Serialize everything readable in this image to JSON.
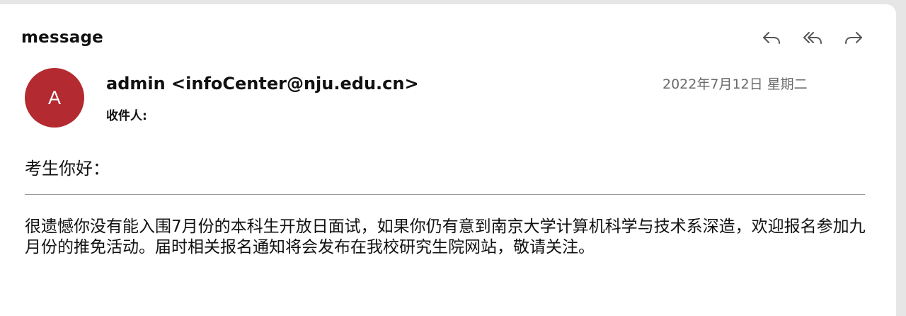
{
  "header": {
    "title": "message"
  },
  "toolbar": {
    "reply_icon": "reply-icon",
    "reply_all_icon": "reply-all-icon",
    "forward_icon": "forward-icon"
  },
  "sender": {
    "avatar_letter": "A",
    "avatar_color": "#b32a30",
    "display": "admin <infoCenter@nju.edu.cn>",
    "recipient_label": "收件人:",
    "date": "2022年7月12日 星期二"
  },
  "body": {
    "greeting": "考生你好：",
    "paragraph": "很遗憾你没有能入围7月份的本科生开放日面试，如果你仍有意到南京大学计算机科学与技术系深造，欢迎报名参加九月份的推免活动。届时相关报名通知将会发布在我校研究生院网站，敬请关注。"
  }
}
